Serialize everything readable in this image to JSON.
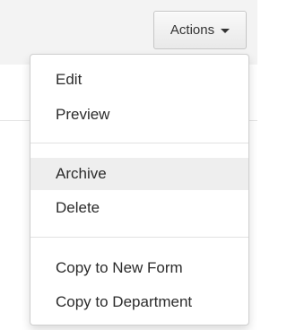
{
  "toolbar": {
    "actions_label": "Actions"
  },
  "menu": {
    "items": [
      {
        "label": "Edit"
      },
      {
        "label": "Preview"
      },
      {
        "label": "Archive",
        "state": "hovered"
      },
      {
        "label": "Delete"
      },
      {
        "label": "Copy to New Form"
      },
      {
        "label": "Copy to Department"
      }
    ]
  },
  "colors": {
    "hover_background": "#eeeeee",
    "text": "#2b2b2b",
    "button_border": "#c6c6c6"
  }
}
